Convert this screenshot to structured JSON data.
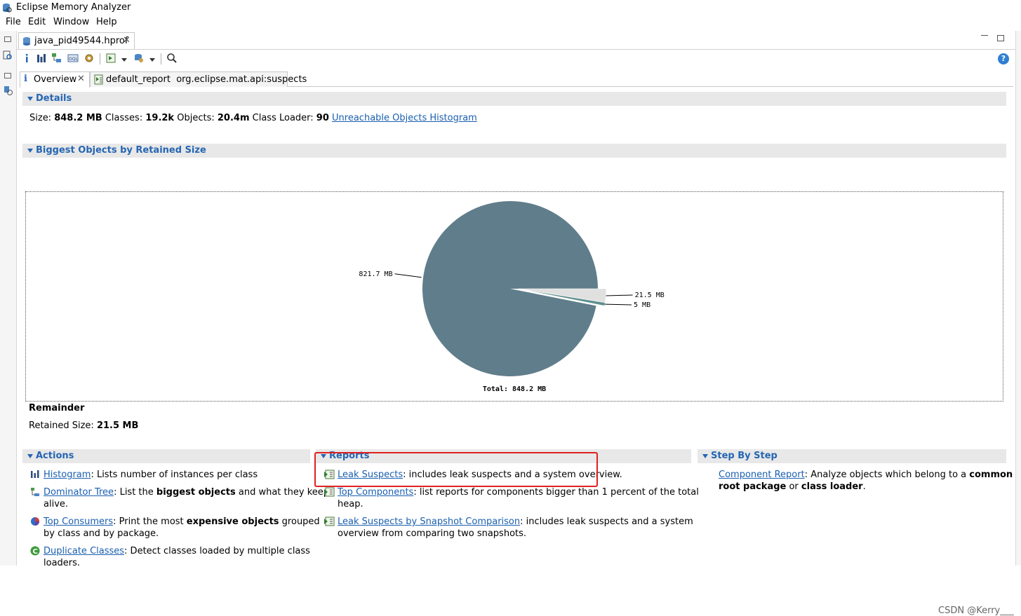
{
  "window": {
    "title": "Eclipse Memory Analyzer"
  },
  "menu": [
    "File",
    "Edit",
    "Window",
    "Help"
  ],
  "editor_tab": {
    "label": "java_pid49544.hprof",
    "close": "✕"
  },
  "help_label": "?",
  "subtabs": [
    {
      "label": "Overview",
      "close": "✕",
      "icon": "info-icon"
    },
    {
      "label": "default_report  org.eclipse.mat.api:suspects",
      "icon": "report-icon"
    }
  ],
  "details": {
    "header": "Details",
    "size_label": "Size:",
    "size_value": "848.2 MB",
    "classes_label": "Classes:",
    "classes_value": "19.2k",
    "objects_label": "Objects:",
    "objects_value": "20.4m",
    "loader_label": "Class Loader:",
    "loader_value": "90",
    "histogram_link": "Unreachable Objects Histogram"
  },
  "biggest": {
    "header": "Biggest Objects by Retained Size",
    "remainder_title": "Remainder",
    "retained_label": "Retained Size:",
    "retained_value": "21.5 MB"
  },
  "chart_data": {
    "type": "pie",
    "unit": "MB",
    "slices": [
      {
        "value": 821.7,
        "label": "821.7 MB",
        "color": "#607d8b"
      },
      {
        "value": 21.5,
        "label": "21.5 MB",
        "color": "#e0e0e0"
      },
      {
        "value": 5,
        "label": "5 MB",
        "color": "#5e8f8f"
      }
    ],
    "total_label": "Total: 848.2 MB"
  },
  "actions": {
    "header": "Actions",
    "items": [
      {
        "link": "Histogram",
        "rest": ": Lists number of instances per class",
        "icon": "histogram-icon"
      },
      {
        "link": "Dominator Tree",
        "rest_before": ": List the ",
        "bold": "biggest objects",
        "rest_after": " and what they keep",
        "line2": "alive.",
        "icon": "dominator-tree-icon"
      },
      {
        "link": "Top Consumers",
        "rest_before": ": Print the most ",
        "bold": "expensive objects",
        "rest_after": " grouped",
        "line2": "by class and by package.",
        "icon": "pie-icon"
      },
      {
        "link": "Duplicate Classes",
        "rest": ": Detect classes loaded by multiple class",
        "line2": "loaders.",
        "icon": "duplicate-classes-icon"
      }
    ]
  },
  "reports": {
    "header": "Reports",
    "items": [
      {
        "link": "Leak Suspects",
        "rest": ": includes leak suspects and a system overview."
      },
      {
        "link": "Top Components",
        "rest": ": list reports for components bigger than 1 percent of the total",
        "line2": "heap."
      },
      {
        "link": "Leak Suspects by Snapshot Comparison",
        "rest": ": includes leak suspects and a system",
        "line2": "overview from comparing two snapshots."
      }
    ]
  },
  "stepbystep": {
    "header": "Step By Step",
    "link": "Component Report",
    "rest": ": Analyze objects which belong to a ",
    "bold1": "common",
    "bold2": "root package",
    "mid": " or ",
    "bold3": "class loader",
    "end": "."
  },
  "watermark": "CSDN @Kerry___"
}
